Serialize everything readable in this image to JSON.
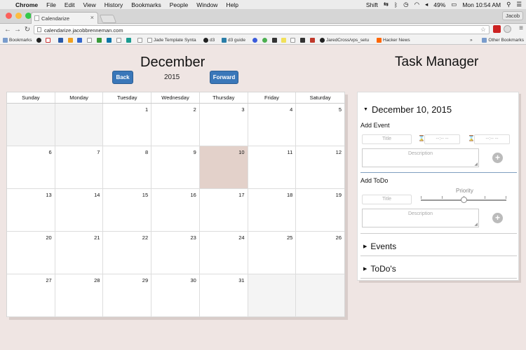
{
  "menubar": {
    "app": "Chrome",
    "items": [
      "File",
      "Edit",
      "View",
      "History",
      "Bookmarks",
      "People",
      "Window",
      "Help"
    ],
    "status_shift": "Shift",
    "battery": "49%",
    "clock": "Mon 10:54 AM"
  },
  "browser": {
    "tab_title": "Calendarize",
    "profile": "Jacob",
    "url": "calendarize.jacobbrenneman.com"
  },
  "bookmarks": {
    "bookmarks_label": "Bookmarks",
    "jade": "Jade Template Synta",
    "d3": "d3",
    "d3guide": "d3 guide",
    "jaredcross": "JaredCross/vps_setu",
    "hn": "Hacker News",
    "more": "»",
    "other": "Other Bookmarks"
  },
  "calendar": {
    "month": "December",
    "year": "2015",
    "back_label": "Back",
    "forward_label": "Forward",
    "weekdays": [
      "Sunday",
      "Monday",
      "Tuesday",
      "Wednesday",
      "Thursday",
      "Friday",
      "Saturday"
    ],
    "days": [
      "",
      "",
      "1",
      "2",
      "3",
      "4",
      "5",
      "6",
      "7",
      "8",
      "9",
      "10",
      "11",
      "12",
      "13",
      "14",
      "15",
      "16",
      "17",
      "18",
      "19",
      "20",
      "21",
      "22",
      "23",
      "24",
      "25",
      "26",
      "27",
      "28",
      "29",
      "30",
      "31",
      "",
      ""
    ],
    "selected_day": "10"
  },
  "task_manager": {
    "title": "Task Manager",
    "date": "December 10, 2015",
    "add_event": {
      "label": "Add Event",
      "title_placeholder": "Title",
      "start_time": "--:-- --",
      "end_time": "--:-- --",
      "description_placeholder": "Description"
    },
    "add_todo": {
      "label": "Add ToDo",
      "title_placeholder": "Title",
      "priority_label": "Priority",
      "priority_value": 0.5,
      "description_placeholder": "Description"
    },
    "events_label": "Events",
    "todos_label": "ToDo's"
  },
  "colors": {
    "accent": "#3a77b9",
    "selected_day": "#e3d1ca",
    "page_bg": "#efe5e3"
  }
}
